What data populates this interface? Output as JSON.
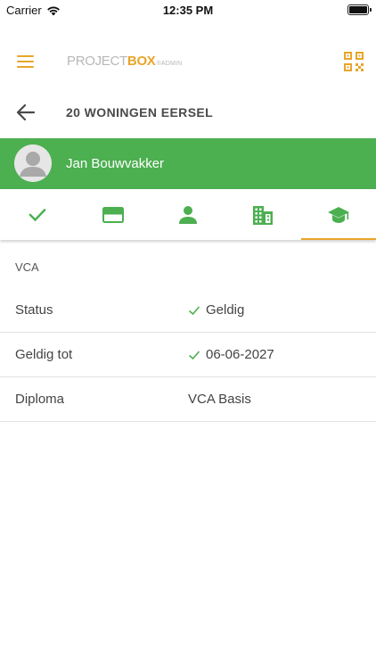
{
  "status_bar": {
    "carrier": "Carrier",
    "time": "12:35 PM"
  },
  "app_bar": {
    "logo": {
      "part1": "PROJECT",
      "part2": "BOX",
      "part3": "®ADMIN"
    }
  },
  "title_row": {
    "title": "20 WONINGEN EERSEL"
  },
  "user": {
    "name": "Jan Bouwvakker"
  },
  "tabs": [
    {
      "icon": "check-icon",
      "active": false
    },
    {
      "icon": "card-icon",
      "active": false
    },
    {
      "icon": "person-icon",
      "active": false
    },
    {
      "icon": "building-icon",
      "active": false
    },
    {
      "icon": "graduation-cap-icon",
      "active": true
    }
  ],
  "section": {
    "title": "VCA",
    "rows": [
      {
        "label": "Status",
        "value": "Geldig",
        "checked": true
      },
      {
        "label": "Geldig tot",
        "value": "06-06-2027",
        "checked": true
      },
      {
        "label": "Diploma",
        "value": "VCA Basis",
        "checked": false
      }
    ]
  },
  "colors": {
    "brand_orange": "#e8a52a",
    "green": "#4caf50",
    "text": "#444444"
  }
}
